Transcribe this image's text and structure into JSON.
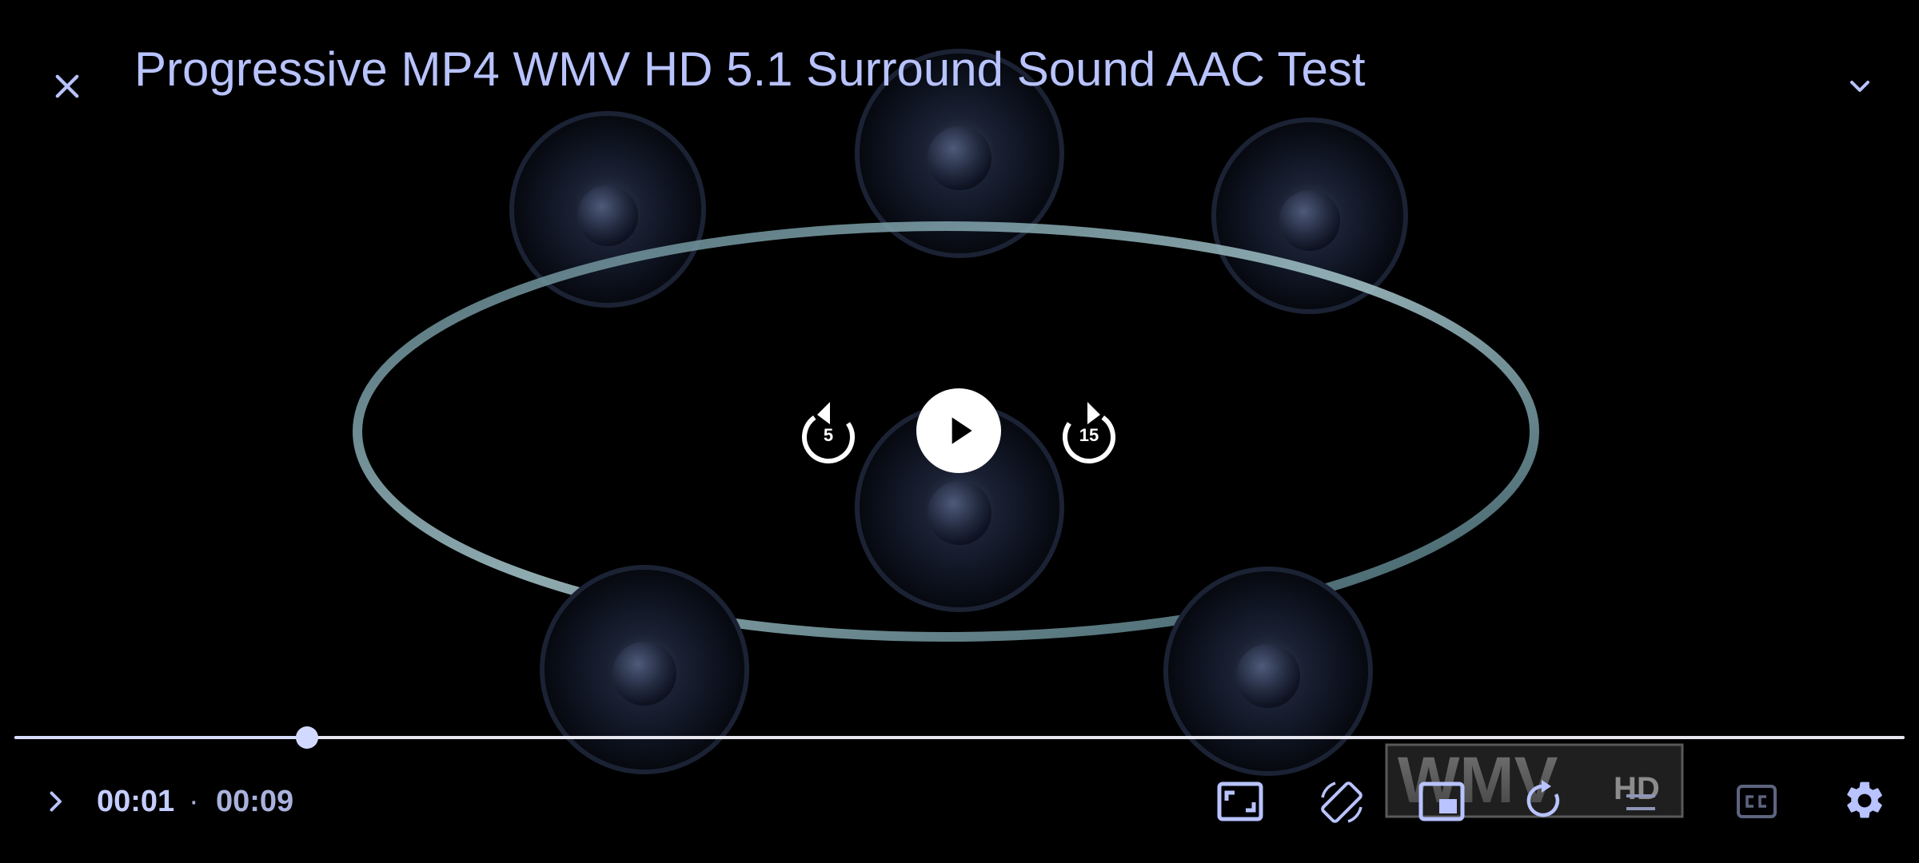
{
  "header": {
    "title": "Progressive MP4 WMV HD 5.1 Surround Sound AAC Test"
  },
  "controls": {
    "rewind_seconds": "5",
    "forward_seconds": "15",
    "position": "00:01",
    "separator": "·",
    "duration": "00:09",
    "progress_fraction": 0.155
  },
  "watermark": {
    "text": "WMV",
    "badge": "HD"
  },
  "icons": {
    "close": "close-icon",
    "collapse": "chevron-down-icon",
    "expand": "chevron-right-icon",
    "play": "play-icon",
    "rewind": "replay-5-icon",
    "forward": "forward-15-icon",
    "aspect": "aspect-ratio-icon",
    "rotate": "screen-rotation-icon",
    "pip": "picture-in-picture-icon",
    "repeat": "repeat-icon",
    "loop": "loop-icon",
    "captions": "closed-captions-icon",
    "settings": "gear-icon"
  },
  "colors": {
    "accent": "#b8c3ff",
    "background": "#000000",
    "play_button": "#ffffff"
  }
}
